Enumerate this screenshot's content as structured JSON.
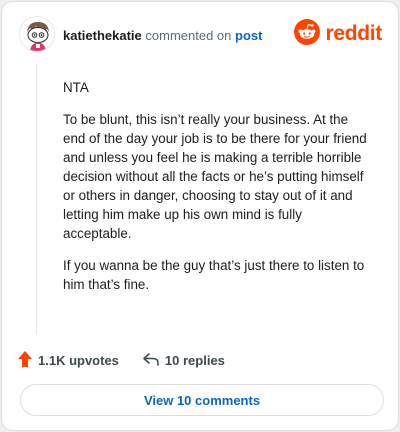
{
  "header": {
    "username": "katiethekatie",
    "action_text": "commented on",
    "post_link": "post",
    "brand": "reddit"
  },
  "comment": {
    "paragraphs": [
      "NTA",
      "To be blunt, this isn’t really your business. At the end of the day your job is to be there for your friend and unless you feel he is making a terrible horrible decision without all the facts or he’s putting himself or others in danger, choosing to stay out of it and letting him make up his own mind is fully acceptable.",
      "If you wanna be the guy that’s just there to listen to him that’s fine."
    ]
  },
  "actions": {
    "upvotes": "1.1K upvotes",
    "replies": "10 replies"
  },
  "view_button": "View 10 comments",
  "colors": {
    "brand": "#ff4500",
    "link": "#0a66c2",
    "upvote": "#ff4500"
  },
  "icons": {
    "avatar": "snoo-avatar-icon",
    "brand": "reddit-logo-icon",
    "upvote": "upvote-arrow-icon",
    "reply": "reply-arrow-icon"
  }
}
